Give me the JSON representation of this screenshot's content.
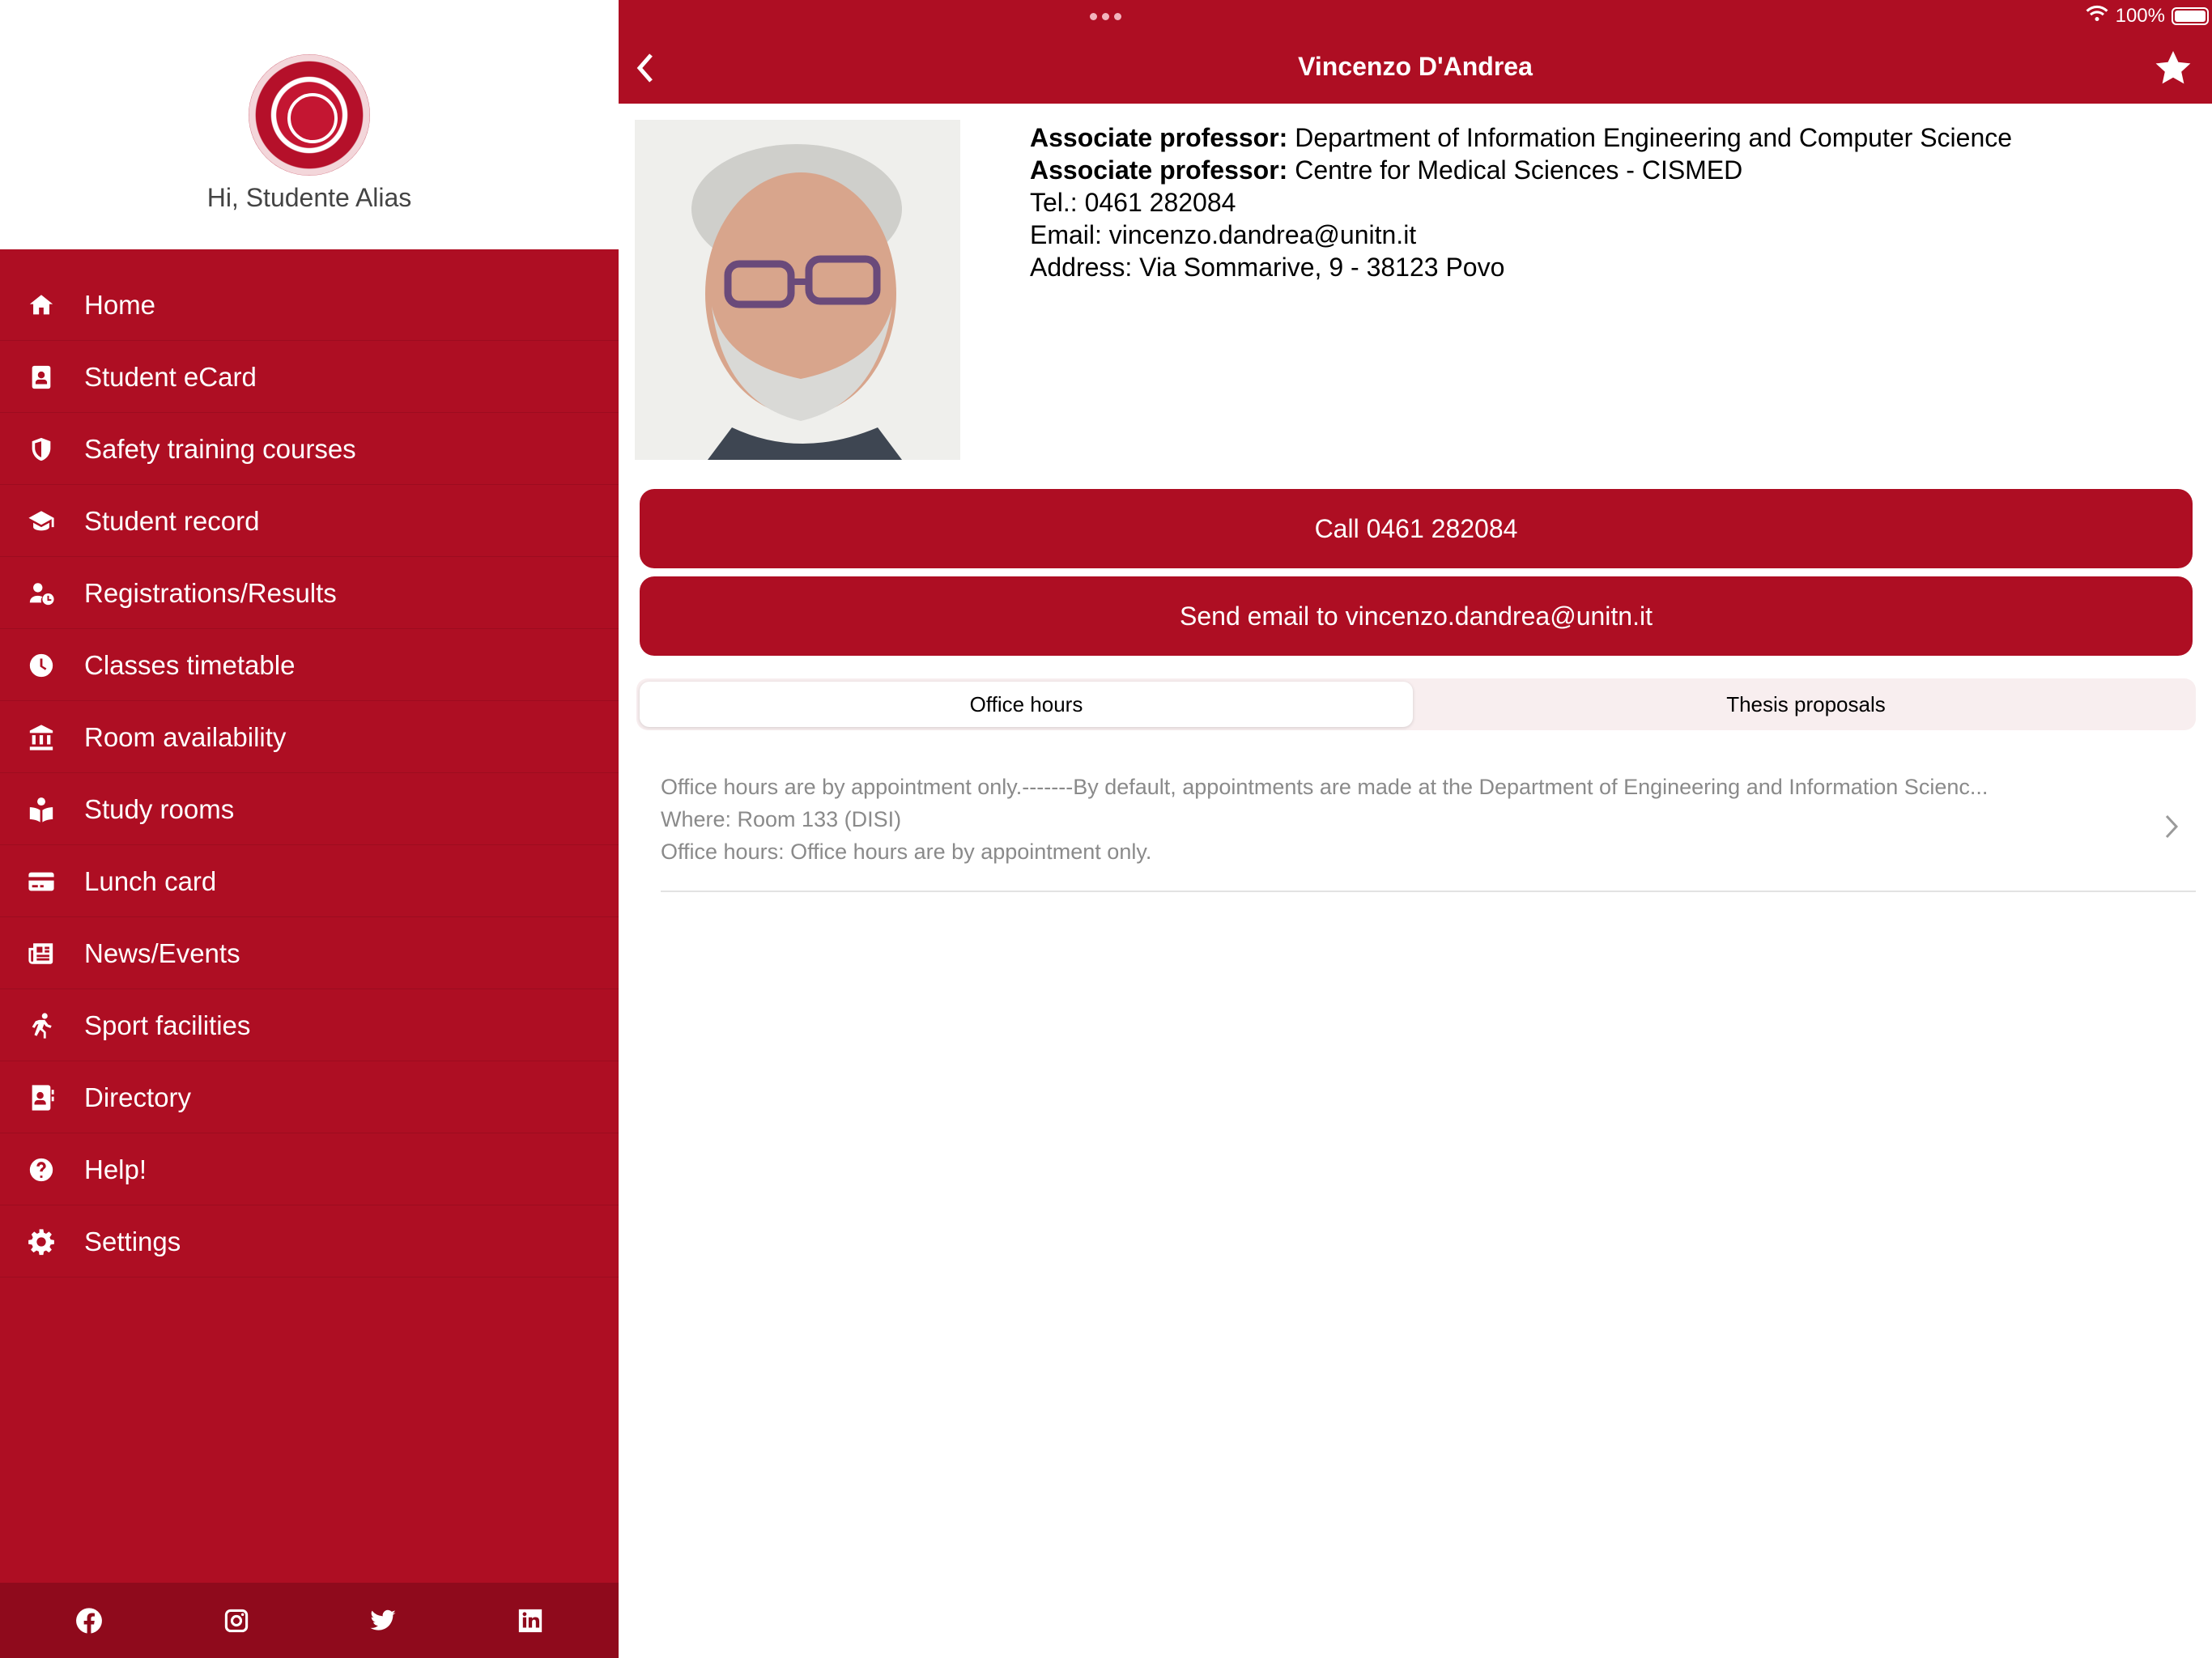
{
  "sidebar": {
    "greeting": "Hi, Studente Alias",
    "items": [
      {
        "label": "Home",
        "icon": "home-icon"
      },
      {
        "label": "Student eCard",
        "icon": "id-card-icon"
      },
      {
        "label": "Safety training courses",
        "icon": "shield-icon"
      },
      {
        "label": "Student record",
        "icon": "graduation-cap-icon"
      },
      {
        "label": "Registrations/Results",
        "icon": "user-clock-icon"
      },
      {
        "label": "Classes timetable",
        "icon": "clock-icon"
      },
      {
        "label": "Room availability",
        "icon": "building-icon"
      },
      {
        "label": "Study rooms",
        "icon": "book-reader-icon"
      },
      {
        "label": "Lunch card",
        "icon": "credit-card-icon"
      },
      {
        "label": "News/Events",
        "icon": "newspaper-icon"
      },
      {
        "label": "Sport facilities",
        "icon": "running-icon"
      },
      {
        "label": "Directory",
        "icon": "address-book-icon"
      },
      {
        "label": "Help!",
        "icon": "question-circle-icon"
      },
      {
        "label": "Settings",
        "icon": "gear-icon"
      }
    ],
    "social": [
      "facebook-icon",
      "instagram-icon",
      "twitter-icon",
      "linkedin-icon"
    ]
  },
  "statusbar": {
    "battery_text": "100%"
  },
  "navbar": {
    "title": "Vincenzo D'Andrea"
  },
  "profile": {
    "role1_label": "Associate professor:",
    "role1_value": " Department of Information Engineering and Computer Science",
    "role2_label": "Associate professor:",
    "role2_value": " Centre for Medical Sciences - CISMED",
    "tel": "Tel.: 0461 282084",
    "email": "Email: vincenzo.dandrea@unitn.it",
    "address": "Address: Via Sommarive, 9 - 38123 Povo"
  },
  "actions": {
    "call_label": "Call 0461 282084",
    "email_label": "Send email to vincenzo.dandrea@unitn.it"
  },
  "tabs": {
    "office_hours": "Office hours",
    "thesis": "Thesis proposals"
  },
  "office_hours": {
    "line1": "Office hours are by appointment only.-------By default, appointments are made at the Department of Engineering and Information Scienc...",
    "line2": "Where: Room 133 (DISI)",
    "line3": "Office hours: Office hours are by appointment only."
  },
  "colors": {
    "brand": "#ae0e23",
    "brand_dark": "#8f0a1c"
  }
}
